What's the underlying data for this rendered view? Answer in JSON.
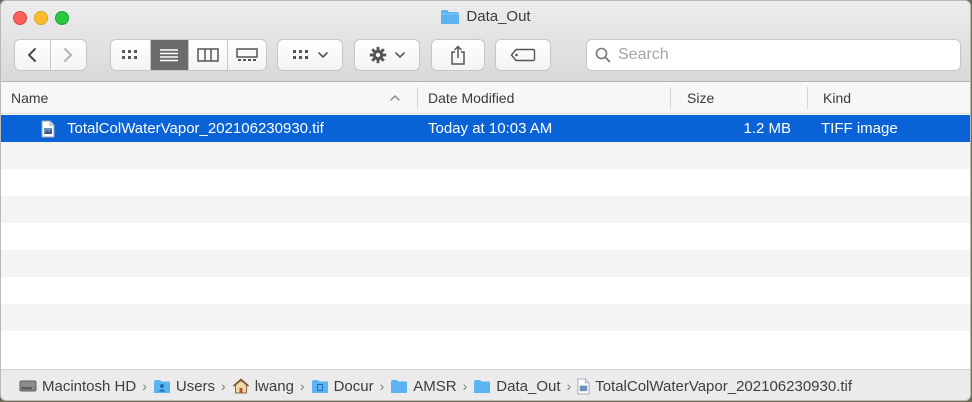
{
  "window": {
    "title": "Data_Out"
  },
  "toolbar": {
    "back_icon": "chevron-left-icon",
    "forward_icon": "chevron-right-icon",
    "view_modes": [
      "icon-view",
      "list-view",
      "column-view",
      "gallery-view"
    ],
    "active_view": "list-view",
    "group_icon": "group-by-icon",
    "action_icon": "gear-icon",
    "share_icon": "share-icon",
    "tag_icon": "tag-icon",
    "search_placeholder": "Search"
  },
  "columns": {
    "name": "Name",
    "date": "Date Modified",
    "size": "Size",
    "kind": "Kind"
  },
  "files": [
    {
      "name": "TotalColWaterVapor_202106230930.tif",
      "date": "Today at 10:03 AM",
      "size": "1.2 MB",
      "kind": "TIFF image",
      "selected": true
    }
  ],
  "pathbar": {
    "items": [
      {
        "label": "Macintosh HD",
        "icon": "hard-drive-icon"
      },
      {
        "label": "Users",
        "icon": "users-folder-icon"
      },
      {
        "label": "lwang",
        "icon": "home-icon"
      },
      {
        "label": "Docur",
        "icon": "documents-folder-icon"
      },
      {
        "label": "AMSR",
        "icon": "folder-icon"
      },
      {
        "label": "Data_Out",
        "icon": "folder-icon"
      },
      {
        "label": "TotalColWaterVapor_202106230930.tif",
        "icon": "file-icon"
      }
    ]
  },
  "colors": {
    "selection": "#0a63d6",
    "folder": "#5bb3ef"
  }
}
